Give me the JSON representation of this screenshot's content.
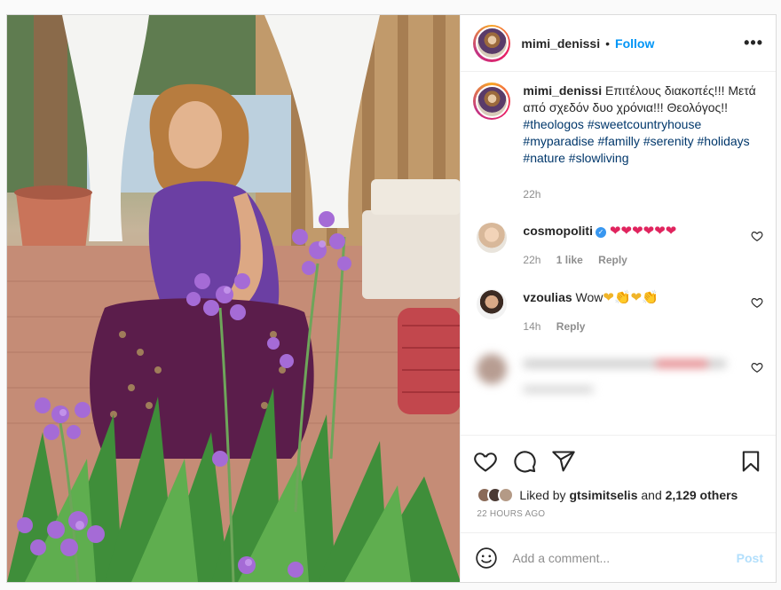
{
  "post": {
    "username": "mimi_denissi",
    "follow_label": "Follow",
    "separator": "•",
    "more_label": "•••"
  },
  "caption": {
    "username": "mimi_denissi",
    "text": "Επιτέλους διακοπές!!! Μετά από σχεδόν δυο χρόνια!!! Θεολόγος!!",
    "hashtags": [
      "#theologos",
      "#sweetcountryhouse",
      "#myparadise",
      "#familly",
      "#serenity",
      "#holidays",
      "#nature",
      "#slowliving"
    ],
    "time": "22h"
  },
  "comments": [
    {
      "username": "cosmopoliti",
      "verified": true,
      "text": "❤❤❤❤❤❤",
      "time": "22h",
      "likes": "1 like",
      "reply": "Reply"
    },
    {
      "username": "vzoulias",
      "text_prefix": "Wow",
      "text_emoji": "❤👏❤👏",
      "time": "14h",
      "reply": "Reply"
    }
  ],
  "actions": {
    "liked_by_prefix": "Liked by",
    "liked_by_user": "gtsimitselis",
    "and": "and",
    "others": "2,129 others",
    "posted_ago": "22 HOURS AGO"
  },
  "add_comment": {
    "placeholder": "Add a comment...",
    "post_label": "Post"
  },
  "colors": {
    "accent": "#0095f6",
    "link": "#00376b",
    "muted": "#8e8e8e",
    "heart": "#e0245e"
  }
}
